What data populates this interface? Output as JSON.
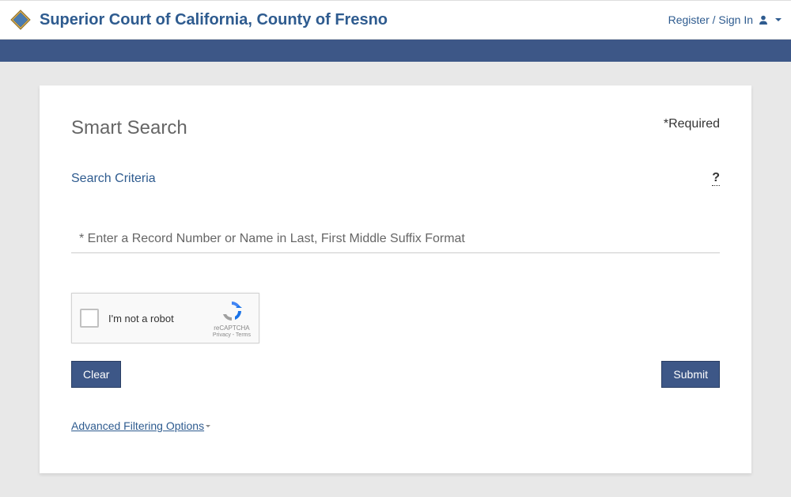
{
  "header": {
    "site_title": "Superior Court of California, County of Fresno",
    "auth_link": "Register / Sign In"
  },
  "main": {
    "page_title": "Smart Search",
    "required_label": "*Required",
    "section_title": "Search Criteria",
    "help_symbol": "?",
    "search_placeholder": "* Enter a Record Number or Name in Last, First Middle Suffix Format",
    "recaptcha": {
      "label": "I'm not a robot",
      "brand": "reCAPTCHA",
      "links": "Privacy - Terms"
    },
    "buttons": {
      "clear": "Clear",
      "submit": "Submit"
    },
    "advanced_link": "Advanced Filtering Options"
  }
}
